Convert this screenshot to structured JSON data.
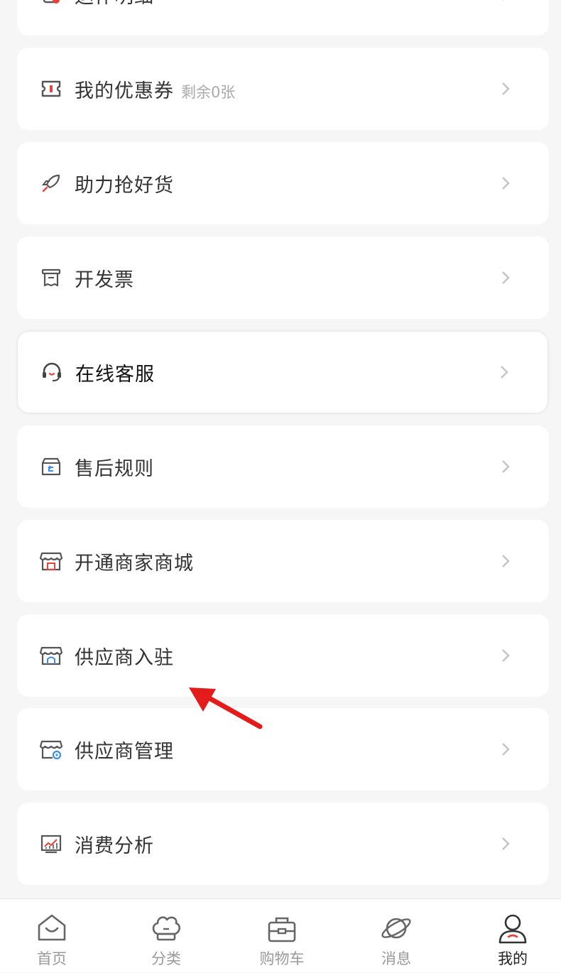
{
  "menu": {
    "partial_top_label": "运作明细",
    "items": [
      {
        "label": "我的优惠券",
        "sub": "剩余0张",
        "icon": "coupon-icon"
      },
      {
        "label": "助力抢好货",
        "icon": "rocket-icon"
      },
      {
        "label": "开发票",
        "icon": "invoice-icon"
      },
      {
        "label": "在线客服",
        "icon": "headset-icon"
      },
      {
        "label": "售后规则",
        "icon": "return-box-icon"
      },
      {
        "label": "开通商家商城",
        "icon": "store-icon"
      },
      {
        "label": "供应商入驻",
        "icon": "supplier-store-icon"
      },
      {
        "label": "供应商管理",
        "icon": "supplier-settings-icon"
      },
      {
        "label": "消费分析",
        "icon": "chart-icon"
      }
    ]
  },
  "tabbar": {
    "tabs": [
      {
        "label": "首页",
        "icon": "home-icon"
      },
      {
        "label": "分类",
        "icon": "category-icon"
      },
      {
        "label": "购物车",
        "icon": "cart-icon"
      },
      {
        "label": "消息",
        "icon": "planet-icon"
      },
      {
        "label": "我的",
        "icon": "profile-icon",
        "active": true
      }
    ]
  },
  "colors": {
    "accent": "#e8423f",
    "annotation_arrow": "#e31b1b",
    "text": "#333333",
    "muted": "#aaaaaa"
  }
}
